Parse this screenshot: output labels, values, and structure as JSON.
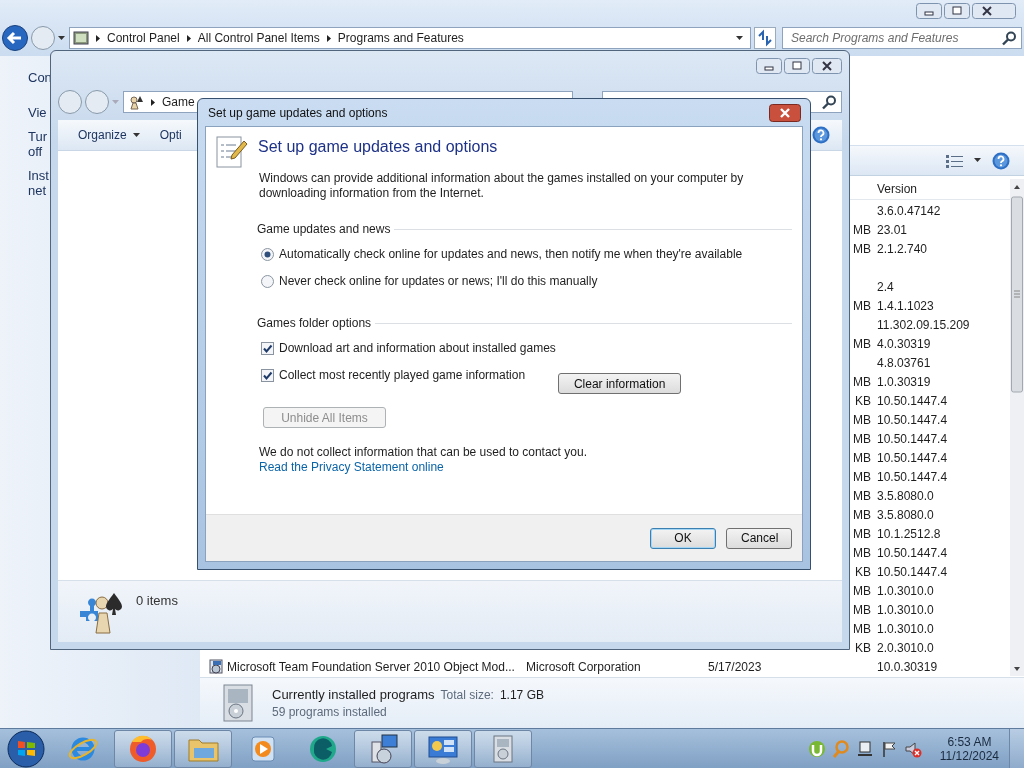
{
  "programs_window": {
    "address": [
      "Control Panel",
      "All Control Panel Items",
      "Programs and Features"
    ],
    "search": {
      "placeholder": "Search Programs and Features"
    },
    "left_pane": [
      "Con",
      "Vie",
      "Tur",
      "off",
      "Inst",
      "net"
    ],
    "columns": [
      {
        "label": "Version"
      }
    ],
    "rows": [
      {
        "version": "3.6.0.47142"
      },
      {
        "size": "MB",
        "version": "23.01"
      },
      {
        "size": "MB",
        "version": "2.1.2.740"
      },
      {},
      {
        "version": "2.4"
      },
      {
        "size": "MB",
        "version": "1.4.1.1023"
      },
      {
        "version": "11.302.09.15.209"
      },
      {
        "size": "MB",
        "version": "4.0.30319"
      },
      {
        "version": "4.8.03761"
      },
      {
        "size": "MB",
        "version": "1.0.30319"
      },
      {
        "size": "KB",
        "version": "10.50.1447.4"
      },
      {
        "size": "MB",
        "version": "10.50.1447.4"
      },
      {
        "size": "MB",
        "version": "10.50.1447.4"
      },
      {
        "size": "MB",
        "version": "10.50.1447.4"
      },
      {
        "size": "MB",
        "version": "10.50.1447.4"
      },
      {
        "size": "MB",
        "version": "3.5.8080.0"
      },
      {
        "size": "MB",
        "version": "3.5.8080.0"
      },
      {
        "size": "MB",
        "version": "10.1.2512.8"
      },
      {
        "size": "MB",
        "version": "10.50.1447.4"
      },
      {
        "size": "KB",
        "version": "10.50.1447.4"
      },
      {
        "size": "MB",
        "version": "1.0.3010.0"
      },
      {
        "size": "MB",
        "version": "1.0.3010.0"
      },
      {
        "size": "MB",
        "version": "1.0.3010.0"
      },
      {
        "size": "KB",
        "version": "2.0.3010.0"
      },
      {
        "name": "Microsoft Team Foundation Server 2010 Object Mod...",
        "publisher": "Microsoft Corporation",
        "installed": "5/17/2023",
        "version": "10.0.30319"
      }
    ],
    "footer": {
      "title": "Currently installed programs",
      "total_label": "Total size:",
      "total": "1.17 GB",
      "count": "59 programs installed"
    }
  },
  "games_window": {
    "address": "Game",
    "toolbar": [
      {
        "label": "Organize",
        "menu": true
      },
      {
        "label": "Opti",
        "menu": false
      }
    ],
    "status": "0 items"
  },
  "dialog": {
    "title": "Set up game updates and options",
    "heading": "Set up game updates and options",
    "intro": "Windows can provide additional information about the games installed on your computer by downloading information from the Internet.",
    "groups": [
      {
        "title": "Game updates and news",
        "options": [
          {
            "kind": "radio",
            "label": "Automatically check online for updates and news, then notify me when they're available",
            "selected": true
          },
          {
            "kind": "radio",
            "label": "Never check online for updates or news; I'll do this manually",
            "selected": false
          }
        ]
      },
      {
        "title": "Games folder options",
        "options": [
          {
            "kind": "checkbox",
            "label": "Download art and information about installed games",
            "checked": true
          },
          {
            "kind": "checkbox",
            "label": "Collect most recently played game information",
            "checked": true,
            "button": "Clear information"
          }
        ],
        "button": {
          "label": "Unhide All Items",
          "disabled": true
        }
      }
    ],
    "privacy_note": "We do not collect information that can be used to contact you.",
    "privacy_link": "Read the Privacy Statement online",
    "buttons": [
      {
        "label": "OK",
        "default": true
      },
      {
        "label": "Cancel",
        "default": false
      }
    ]
  },
  "taskbar": {
    "items": [
      {
        "kind": "ie",
        "open": false
      },
      {
        "kind": "firefox",
        "open": true
      },
      {
        "kind": "explorer",
        "open": true
      },
      {
        "kind": "media",
        "open": false
      },
      {
        "kind": "app",
        "open": false
      },
      {
        "kind": "installer",
        "open": true
      },
      {
        "kind": "control-panel",
        "open": true
      },
      {
        "kind": "programs",
        "open": true
      }
    ],
    "tray": [
      {
        "kind": "utorrent"
      },
      {
        "kind": "search-app"
      },
      {
        "kind": "network"
      },
      {
        "kind": "flag"
      },
      {
        "kind": "volume-muted"
      }
    ],
    "time": "6:53 AM",
    "date": "11/12/2024"
  }
}
